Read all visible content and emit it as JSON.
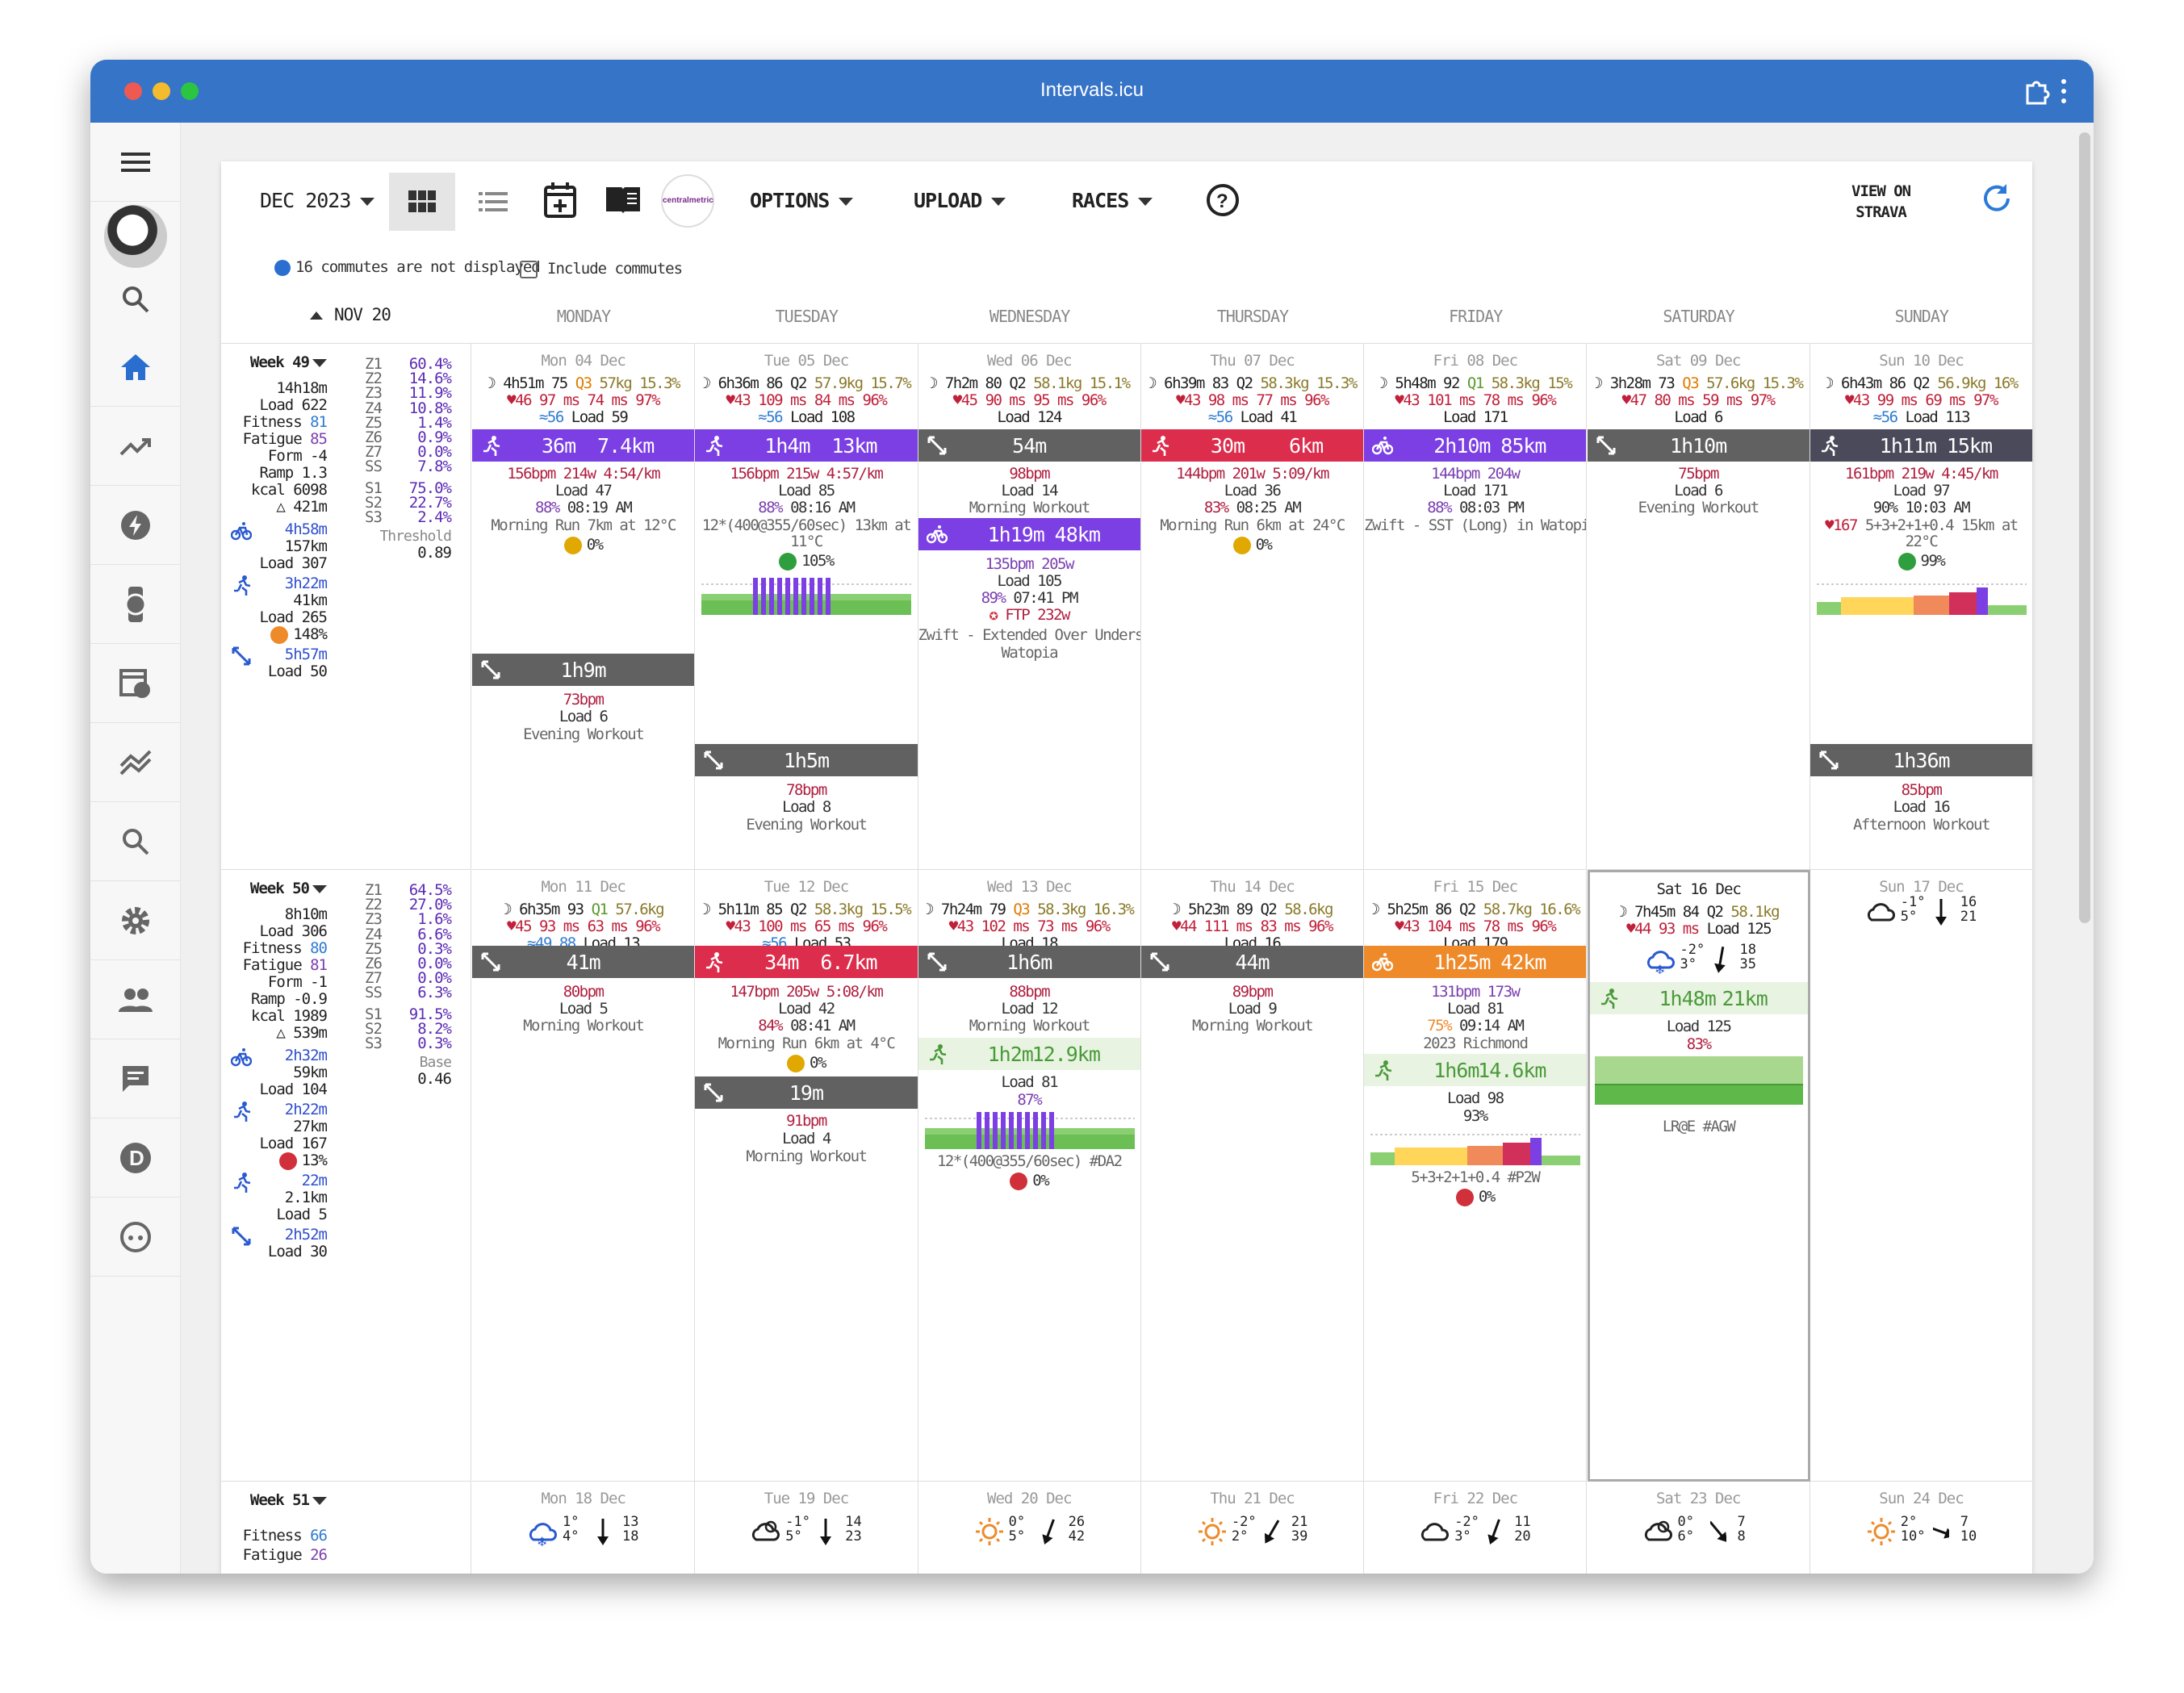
{
  "app": {
    "title": "Intervals.icu"
  },
  "toolbar": {
    "month": "DEC 2023",
    "options": "OPTIONS",
    "upload": "UPLOAD",
    "races": "RACES",
    "view_on": "VIEW ON",
    "strava": "STRAVA",
    "brand": "centralmetric"
  },
  "notice": {
    "commutes": "16 commutes are not displayed",
    "include": "Include commutes"
  },
  "nav": {
    "prev": "NOV 20"
  },
  "days": [
    "MONDAY",
    "TUESDAY",
    "WEDNESDAY",
    "THURSDAY",
    "FRIDAY",
    "SATURDAY",
    "SUNDAY"
  ],
  "week49": {
    "label": "Week 49",
    "dur": "14h18m",
    "load": "Load 622",
    "fitness_l": "Fitness",
    "fitness": "81",
    "fatigue_l": "Fatigue",
    "fatigue": "85",
    "form": "Form -4",
    "ramp": "Ramp 1.3",
    "kcal": "kcal 6098",
    "elev": "421m",
    "ride_t": "4h58m",
    "ride_d": "157km",
    "ride_l": "Load 307",
    "run_t": "3h22m",
    "run_d": "41km",
    "run_l": "Load 265",
    "run_pct": "148%",
    "oth_t": "5h57m",
    "oth_l": "Load 50",
    "zones": [
      [
        "Z1",
        "60.4%"
      ],
      [
        "Z2",
        "14.6%"
      ],
      [
        "Z3",
        "11.9%"
      ],
      [
        "Z4",
        "10.8%"
      ],
      [
        "Z5",
        "1.4%"
      ],
      [
        "Z6",
        "0.9%"
      ],
      [
        "Z7",
        "0.0%"
      ],
      [
        "SS",
        "7.8%"
      ]
    ],
    "szones": [
      [
        "S1",
        "75.0%"
      ],
      [
        "S2",
        "22.7%"
      ],
      [
        "S3",
        "2.4%"
      ]
    ],
    "extra_l": "Threshold",
    "extra_v": "0.89"
  },
  "week50": {
    "label": "Week 50",
    "dur": "8h10m",
    "load": "Load 306",
    "fitness_l": "Fitness",
    "fitness": "80",
    "fatigue_l": "Fatigue",
    "fatigue": "81",
    "form": "Form -1",
    "ramp": "Ramp -0.9",
    "kcal": "kcal 1989",
    "elev": "539m",
    "ride_t": "2h32m",
    "ride_d": "59km",
    "ride_l": "Load 104",
    "run_t": "2h22m",
    "run_d": "27km",
    "run_l": "Load 167",
    "run_pct": "13%",
    "walk_t": "22m",
    "walk_d": "2.1km",
    "walk_l": "Load 5",
    "oth_t": "2h52m",
    "oth_l": "Load 30",
    "zones": [
      [
        "Z1",
        "64.5%"
      ],
      [
        "Z2",
        "27.0%"
      ],
      [
        "Z3",
        "1.6%"
      ],
      [
        "Z4",
        "6.6%"
      ],
      [
        "Z5",
        "0.3%"
      ],
      [
        "Z6",
        "0.0%"
      ],
      [
        "Z7",
        "0.0%"
      ],
      [
        "SS",
        "6.3%"
      ]
    ],
    "szones": [
      [
        "S1",
        "91.5%"
      ],
      [
        "S2",
        "8.2%"
      ],
      [
        "S3",
        "0.3%"
      ]
    ],
    "extra_l": "Base",
    "extra_v": "0.46"
  },
  "week51": {
    "label": "Week 51",
    "fitness_l": "Fitness",
    "fitness": "66",
    "fatigue_l": "Fatigue",
    "fatigue": "26"
  },
  "w49": [
    {
      "date": "Mon 04 Dec",
      "sleep": "4h51m 75",
      "q": "Q3",
      "w": "57kg",
      "bf": "15.3%",
      "hr": "46",
      "hrv": "97 ms",
      "hrv2": "74 ms",
      "sp": "97%",
      "steps": "56",
      "load": "Load 59",
      "a1": {
        "dur": "36m",
        "dist": "7.4km"
      },
      "a1l1": "156bpm 214w 4:54/km",
      "a1l2": "Load 47",
      "a1l3": "88%",
      "a1l3b": "08:19 AM",
      "a1l4": "Morning Run 7km at 12°C",
      "a1l5": "0%",
      "a2": {
        "dur": "1h9m"
      },
      "a2l1": "73bpm",
      "a2l2": "Load 6",
      "a2l3": "Evening Workout"
    },
    {
      "date": "Tue 05 Dec",
      "sleep": "6h36m 86",
      "q": "Q2",
      "w": "57.9kg",
      "bf": "15.7%",
      "hr": "43",
      "hrv": "109 ms",
      "hrv2": "84 ms",
      "sp": "96%",
      "steps": "56",
      "load": "Load 108",
      "a1": {
        "dur": "1h4m",
        "dist": "13km"
      },
      "a1l1": "156bpm 215w 4:57/km",
      "a1l2": "Load 85",
      "a1l3": "88%",
      "a1l3b": "08:16 AM",
      "a1l4": "12*(400@355/60sec) 13km at",
      "a1l4b": "11°C",
      "a1l5": "105%",
      "a2": {
        "dur": "1h5m"
      },
      "a2l1": "78bpm",
      "a2l2": "Load 8",
      "a2l3": "Evening Workout"
    },
    {
      "date": "Wed 06 Dec",
      "sleep": "7h2m 80",
      "q": "Q2",
      "w": "58.1kg",
      "bf": "15.1%",
      "hr": "45",
      "hrv": "90 ms",
      "hrv2": "95 ms",
      "sp": "96%",
      "load": "Load 124",
      "a1": {
        "dur": "54m"
      },
      "a1l1": "98bpm",
      "a1l2": "Load 14",
      "a1l3": "Morning Workout",
      "a2": {
        "dur": "1h19m",
        "dist": "48km"
      },
      "a2l1": "135bpm 205w",
      "a2l2": "Load 105",
      "a2l3": "89%",
      "a2l3b": "07:41 PM",
      "a2l4": "FTP 232w",
      "a2l5": "Zwift - Extended Over Unders in",
      "a2l6": "Watopia"
    },
    {
      "date": "Thu 07 Dec",
      "sleep": "6h39m 83",
      "q": "Q2",
      "w": "58.3kg",
      "bf": "15.3%",
      "hr": "43",
      "hrv": "98 ms",
      "hrv2": "77 ms",
      "sp": "96%",
      "steps": "56",
      "load": "Load 41",
      "a1": {
        "dur": "30m",
        "dist": "6km"
      },
      "a1l1": "144bpm 201w 5:09/km",
      "a1l2": "Load 36",
      "a1l3": "83%",
      "a1l3b": "08:25 AM",
      "a1l4": "Morning Run 6km at 24°C",
      "a1l5": "0%"
    },
    {
      "date": "Fri 08 Dec",
      "sleep": "5h48m 92",
      "q": "Q1",
      "w": "58.3kg",
      "bf": "15%",
      "hr": "43",
      "hrv": "101 ms",
      "hrv2": "78 ms",
      "sp": "96%",
      "load": "Load 171",
      "a1": {
        "dur": "2h10m",
        "dist": "85km"
      },
      "a1l1": "144bpm 204w",
      "a1l2": "Load 171",
      "a1l3": "88%",
      "a1l3b": "08:03 PM",
      "a1l4": "Zwift - SST (Long) in Watopia"
    },
    {
      "date": "Sat 09 Dec",
      "sleep": "3h28m 73",
      "q": "Q3",
      "w": "57.6kg",
      "bf": "15.3%",
      "hr": "47",
      "hrv": "80 ms",
      "hrv2": "59 ms",
      "sp": "97%",
      "load": "Load 6",
      "a1": {
        "dur": "1h10m"
      },
      "a1l1": "75bpm",
      "a1l2": "Load 6",
      "a1l3": "Evening Workout"
    },
    {
      "date": "Sun 10 Dec",
      "sleep": "6h43m 86",
      "q": "Q2",
      "w": "56.9kg",
      "bf": "16%",
      "hr": "43",
      "hrv": "99 ms",
      "hrv2": "69 ms",
      "sp": "97%",
      "steps": "56",
      "load": "Load 113",
      "a1": {
        "dur": "1h11m",
        "dist": "15km"
      },
      "a1l1": "161bpm 219w 4:45/km",
      "a1l2": "Load 97",
      "a1l3": "90%",
      "a1l3b": "10:03 AM",
      "a1l4a": "167",
      "a1l4": "5+3+2+1+0.4 15km at",
      "a1l4b": "22°C",
      "a1l5": "99%",
      "a2": {
        "dur": "1h36m"
      },
      "a2l1": "85bpm",
      "a2l2": "Load 16",
      "a2l3": "Afternoon Workout"
    }
  ],
  "w50": [
    {
      "date": "Mon 11 Dec",
      "sleep": "6h35m 93",
      "q": "Q1",
      "w": "57.6kg",
      "hr": "45",
      "hrv": "93 ms",
      "hrv2": "63 ms",
      "sp": "96%",
      "steps": "49.88",
      "load": "Load 13",
      "a1": {
        "dur": "41m"
      },
      "a1l1": "80bpm",
      "a1l2": "Load 5",
      "a1l3": "Morning Workout"
    },
    {
      "date": "Tue 12 Dec",
      "sleep": "5h11m 85",
      "q": "Q2",
      "w": "58.3kg",
      "bf": "15.5%",
      "hr": "43",
      "hrv": "100 ms",
      "hrv2": "65 ms",
      "sp": "96%",
      "steps": "56",
      "load": "Load 53",
      "a1": {
        "dur": "34m",
        "dist": "6.7km"
      },
      "a1l1": "147bpm 205w 5:08/km",
      "a1l2": "Load 42",
      "a1l3": "84%",
      "a1l3b": "08:41 AM",
      "a1l4": "Morning Run 6km at 4°C",
      "a1l5": "0%",
      "a2": {
        "dur": "19m"
      },
      "a2l1": "91bpm",
      "a2l2": "Load 4",
      "a2l3": "Morning Workout"
    },
    {
      "date": "Wed 13 Dec",
      "sleep": "7h24m 79",
      "q": "Q3",
      "w": "58.3kg",
      "bf": "16.3%",
      "hr": "43",
      "hrv": "102 ms",
      "hrv2": "73 ms",
      "sp": "96%",
      "load": "Load 18",
      "a1": {
        "dur": "1h6m"
      },
      "a1l1": "88bpm",
      "a1l2": "Load 12",
      "a1l3": "Morning Workout",
      "a2": {
        "dur": "1h2m",
        "dist": "12.9km"
      },
      "a2l1": "Load 81",
      "a2l2": "87%",
      "a2l3": "12*(400@355/60sec) #DA2",
      "a2l4": "0%"
    },
    {
      "date": "Thu 14 Dec",
      "sleep": "5h23m 89",
      "q": "Q2",
      "w": "58.6kg",
      "hr": "44",
      "hrv": "111 ms",
      "hrv2": "83 ms",
      "sp": "96%",
      "load": "Load 16",
      "a1": {
        "dur": "44m"
      },
      "a1l1": "89bpm",
      "a1l2": "Load 9",
      "a1l3": "Morning Workout"
    },
    {
      "date": "Fri 15 Dec",
      "sleep": "5h25m 86",
      "q": "Q2",
      "w": "58.7kg",
      "bf": "16.6%",
      "hr": "43",
      "hrv": "104 ms",
      "hrv2": "78 ms",
      "sp": "96%",
      "load": "Load 179",
      "a1": {
        "dur": "1h25m",
        "dist": "42km"
      },
      "a1l1": "131bpm 173w",
      "a1l2": "Load 81",
      "a1l3": "75%",
      "a1l3b": "09:14 AM",
      "a1l4": "2023 Richmond",
      "a2": {
        "dur": "1h6m",
        "dist": "14.6km"
      },
      "a2l1": "Load 98",
      "a2l2": "93%",
      "a2l3": "5+3+2+1+0.4 #P2W",
      "a2l4": "0%"
    },
    {
      "date": "Sat 16 Dec",
      "sleep": "7h45m 84",
      "q": "Q2",
      "w": "58.1kg",
      "hr": "44",
      "hrv": "93 ms",
      "load": "Load 125",
      "wx_t1": "-2°",
      "wx_t2": "3°",
      "wx_w1": "18",
      "wx_w2": "35",
      "a1": {
        "dur": "1h48m",
        "dist": "21km"
      },
      "a1l1": "Load 125",
      "a1l2": "83%",
      "a1l3": "LR@E #AGW"
    },
    {
      "date": "Sun 17 Dec",
      "wx_t1": "-1°",
      "wx_t2": "5°",
      "wx_w1": "16",
      "wx_w2": "21"
    }
  ],
  "w51": [
    {
      "date": "Mon 18 Dec",
      "t1": "1°",
      "t2": "4°",
      "w1": "13",
      "w2": "18"
    },
    {
      "date": "Tue 19 Dec",
      "t1": "-1°",
      "t2": "5°",
      "w1": "14",
      "w2": "23"
    },
    {
      "date": "Wed 20 Dec",
      "t1": "0°",
      "t2": "5°",
      "w1": "26",
      "w2": "42"
    },
    {
      "date": "Thu 21 Dec",
      "t1": "-2°",
      "t2": "2°",
      "w1": "21",
      "w2": "39"
    },
    {
      "date": "Fri 22 Dec",
      "t1": "-2°",
      "t2": "3°",
      "w1": "11",
      "w2": "20"
    },
    {
      "date": "Sat 23 Dec",
      "t1": "0°",
      "t2": "6°",
      "w1": "7",
      "w2": "8"
    },
    {
      "date": "Sun 24 Dec",
      "t1": "2°",
      "t2": "10°",
      "w1": "7",
      "w2": "10"
    }
  ]
}
